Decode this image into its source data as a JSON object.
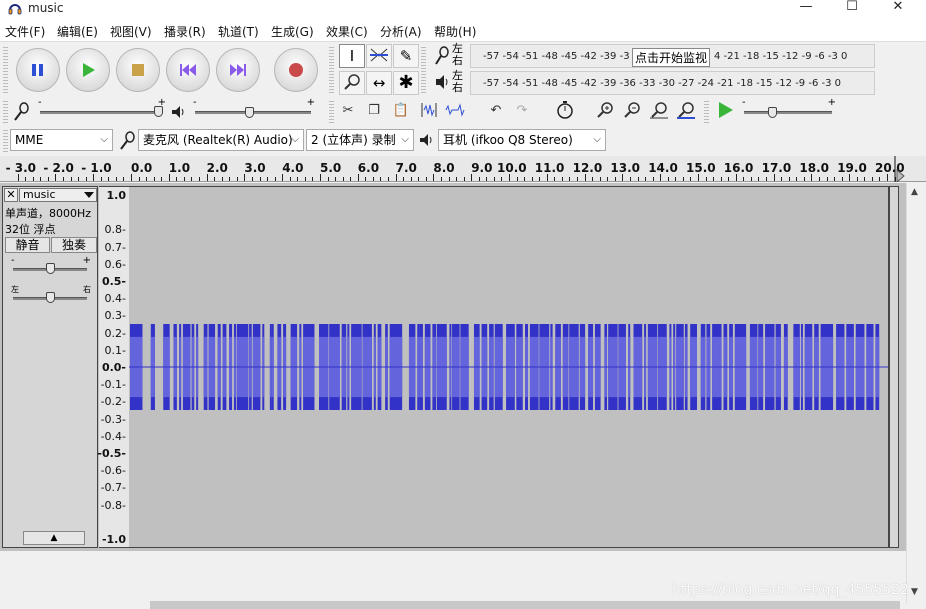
{
  "window": {
    "title": "music",
    "min": "—",
    "max": "☐",
    "close": "✕"
  },
  "menu": [
    "文件(F)",
    "编辑(E)",
    "视图(V)",
    "播录(R)",
    "轨道(T)",
    "生成(G)",
    "效果(C)",
    "分析(A)",
    "帮助(H)"
  ],
  "meters": {
    "record_lr": "左\n右",
    "play_lr": "左\n右",
    "record_scale": "-57 -54 -51 -48 -45 -42 -39 -3",
    "record_scale_tail": "4 -21 -18 -15 -12 -9 -6 -3 0",
    "monitor_label": "点击开始监视",
    "play_scale": "-57 -54 -51 -48 -45 -42 -39 -36 -33 -30 -27 -24 -21 -18 -15 -12 -9 -6 -3 0"
  },
  "mixer": {
    "minus": "-",
    "plus": "+"
  },
  "devices": {
    "host": "MME",
    "input": "麦克风 (Realtek(R) Audio)",
    "channels": "2 (立体声) 录制",
    "output": "耳机 (ifkoo Q8 Stereo)"
  },
  "ruler": {
    "labels": [
      "- 3.0",
      "- 2.0",
      "- 1.0",
      "0.0",
      "1.0",
      "2.0",
      "3.0",
      "4.0",
      "5.0",
      "6.0",
      "7.0",
      "8.0",
      "9.0",
      "10.0",
      "11.0",
      "12.0",
      "13.0",
      "14.0",
      "15.0",
      "16.0",
      "17.0",
      "18.0",
      "19.0",
      "20.0"
    ]
  },
  "track": {
    "close": "✕",
    "name": "music",
    "info1": "单声道，8000Hz",
    "info2": "32位 浮点",
    "mute": "静音",
    "solo": "独奏",
    "gain_minus": "-",
    "gain_plus": "+",
    "pan_left": "左",
    "pan_right": "右",
    "collapse": "▲"
  },
  "scale": {
    "labels": [
      "1.0",
      "0.8-",
      "0.7-",
      "0.6-",
      "0.5-",
      "0.4-",
      "0.3-",
      "0.2-",
      "0.1-",
      "0.0-",
      "-0.1-",
      "-0.2-",
      "-0.3-",
      "-0.4-",
      "-0.5-",
      "-0.6-",
      "-0.7-",
      "-0.8-",
      "-1.0"
    ]
  },
  "waveform": {
    "bursts": [
      [
        0.0,
        0.33
      ],
      [
        0.55,
        0.66
      ],
      [
        0.88,
        1.05
      ],
      [
        1.15,
        1.24
      ],
      [
        1.3,
        1.34
      ],
      [
        1.4,
        1.6
      ],
      [
        1.63,
        1.7
      ],
      [
        1.75,
        1.79
      ],
      [
        1.95,
        2.05
      ],
      [
        2.08,
        2.25
      ],
      [
        2.32,
        2.4
      ],
      [
        2.45,
        2.55
      ],
      [
        2.62,
        2.7
      ],
      [
        2.75,
        2.81
      ],
      [
        2.83,
        3.13
      ],
      [
        3.15,
        3.22
      ],
      [
        3.25,
        3.45
      ],
      [
        3.5,
        3.55
      ],
      [
        3.7,
        3.73
      ],
      [
        3.75,
        3.78
      ],
      [
        3.9,
        4.0
      ],
      [
        4.05,
        4.13
      ],
      [
        4.25,
        4.42
      ],
      [
        4.48,
        4.53
      ],
      [
        4.58,
        4.88
      ],
      [
        5.0,
        5.25
      ],
      [
        5.27,
        5.55
      ],
      [
        5.6,
        5.72
      ],
      [
        5.75,
        5.8
      ],
      [
        5.85,
        6.13
      ],
      [
        6.15,
        6.4
      ],
      [
        6.45,
        6.5
      ],
      [
        6.55,
        6.65
      ],
      [
        6.75,
        6.82
      ],
      [
        6.87,
        7.2
      ],
      [
        7.38,
        7.55
      ],
      [
        7.6,
        7.62
      ],
      [
        7.65,
        7.75
      ],
      [
        7.8,
        7.95
      ],
      [
        8.0,
        8.1
      ],
      [
        8.12,
        8.38
      ],
      [
        8.45,
        8.5
      ],
      [
        8.52,
        8.72
      ],
      [
        8.74,
        8.96
      ],
      [
        9.1,
        9.25
      ],
      [
        9.3,
        9.45
      ],
      [
        9.5,
        9.62
      ],
      [
        9.65,
        9.86
      ],
      [
        9.95,
        10.18
      ],
      [
        10.22,
        10.39
      ],
      [
        10.45,
        10.53
      ],
      [
        10.58,
        10.81
      ],
      [
        10.83,
        11.09
      ],
      [
        11.12,
        11.18
      ],
      [
        11.25,
        11.4
      ],
      [
        11.45,
        11.6
      ],
      [
        11.62,
        11.87
      ],
      [
        11.9,
        12.04
      ],
      [
        12.12,
        12.25
      ],
      [
        12.3,
        12.45
      ],
      [
        12.55,
        12.62
      ],
      [
        12.65,
        12.9
      ],
      [
        12.92,
        13.12
      ],
      [
        13.18,
        13.23
      ],
      [
        13.32,
        13.55
      ],
      [
        13.6,
        13.65
      ],
      [
        13.7,
        13.95
      ],
      [
        13.97,
        14.2
      ],
      [
        14.27,
        14.32
      ],
      [
        14.37,
        14.42
      ],
      [
        14.45,
        14.65
      ],
      [
        14.68,
        14.75
      ],
      [
        14.82,
        15.0
      ],
      [
        15.1,
        15.22
      ],
      [
        15.25,
        15.35
      ],
      [
        15.4,
        15.65
      ],
      [
        15.7,
        15.8
      ],
      [
        15.85,
        15.95
      ],
      [
        16.0,
        16.3
      ],
      [
        16.4,
        16.6
      ],
      [
        16.62,
        16.75
      ],
      [
        16.8,
        17.05
      ],
      [
        17.08,
        17.22
      ],
      [
        17.3,
        17.4
      ],
      [
        17.55,
        17.72
      ],
      [
        17.75,
        17.8
      ],
      [
        17.85,
        18.05
      ],
      [
        18.1,
        18.22
      ],
      [
        18.27,
        18.6
      ],
      [
        18.68,
        18.9
      ],
      [
        18.95,
        19.15
      ],
      [
        19.2,
        19.43
      ],
      [
        19.48,
        19.67
      ],
      [
        19.72,
        19.82
      ]
    ],
    "amplitude": 0.25
  },
  "watermark": "https://blog.csdn.net/qq_4555522"
}
